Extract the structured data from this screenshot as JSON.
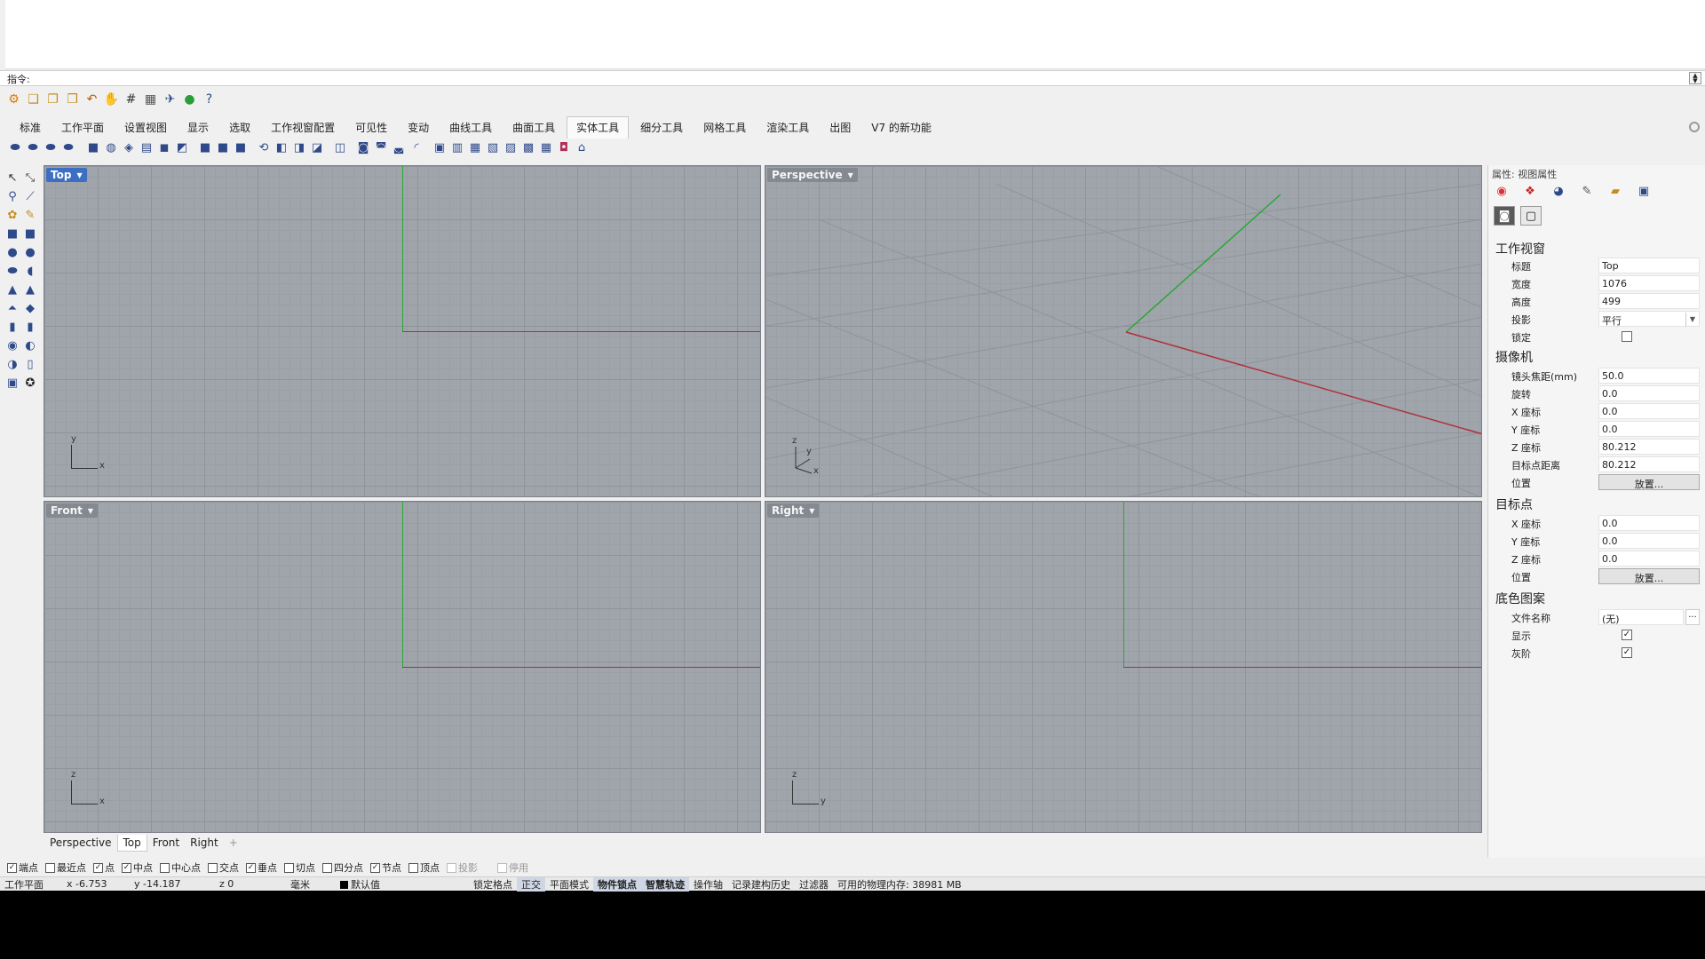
{
  "command": {
    "prompt_label": "指令:"
  },
  "tabs": [
    "标准",
    "工作平面",
    "设置视图",
    "显示",
    "选取",
    "工作视窗配置",
    "可见性",
    "变动",
    "曲线工具",
    "曲面工具",
    "实体工具",
    "细分工具",
    "网格工具",
    "渲染工具",
    "出图",
    "V7 的新功能"
  ],
  "active_tab": "实体工具",
  "viewports": {
    "top": {
      "title": "Top",
      "gizmo_v": "y",
      "gizmo_h": "x"
    },
    "perspective": {
      "title": "Perspective",
      "gizmo_z": "z",
      "gizmo_y": "y",
      "gizmo_x": "x"
    },
    "front": {
      "title": "Front",
      "gizmo_v": "z",
      "gizmo_h": "x"
    },
    "right": {
      "title": "Right",
      "gizmo_v": "z",
      "gizmo_h": "y"
    }
  },
  "view_tabs": [
    "Perspective",
    "Top",
    "Front",
    "Right"
  ],
  "view_tab_add": "+",
  "panel": {
    "title": "属性: 视图属性",
    "sections": {
      "viewport": "工作视窗",
      "camera": "摄像机",
      "target": "目标点",
      "wallpaper": "底色图案"
    },
    "viewport_rows": [
      {
        "label": "标题",
        "value": "Top"
      },
      {
        "label": "宽度",
        "value": "1076"
      },
      {
        "label": "高度",
        "value": "499"
      },
      {
        "label": "投影",
        "value": "平行"
      },
      {
        "label": "锁定",
        "value": ""
      }
    ],
    "camera_rows": [
      {
        "label": "镜头焦距(mm)",
        "value": "50.0"
      },
      {
        "label": "旋转",
        "value": "0.0"
      },
      {
        "label": "X 座标",
        "value": "0.0"
      },
      {
        "label": "Y 座标",
        "value": "0.0"
      },
      {
        "label": "Z 座标",
        "value": "80.212"
      },
      {
        "label": "目标点距离",
        "value": "80.212"
      },
      {
        "label": "位置",
        "value": "放置..."
      }
    ],
    "target_rows": [
      {
        "label": "X 座标",
        "value": "0.0"
      },
      {
        "label": "Y 座标",
        "value": "0.0"
      },
      {
        "label": "Z 座标",
        "value": "0.0"
      },
      {
        "label": "位置",
        "value": "放置..."
      }
    ],
    "wallpaper_rows": [
      {
        "label": "文件名称",
        "value": "(无)"
      },
      {
        "label": "显示",
        "value": "✓"
      },
      {
        "label": "灰阶",
        "value": "✓"
      }
    ],
    "browse_label": "..."
  },
  "osnaps": [
    {
      "label": "端点",
      "checked": true
    },
    {
      "label": "最近点",
      "checked": false
    },
    {
      "label": "点",
      "checked": true
    },
    {
      "label": "中点",
      "checked": true
    },
    {
      "label": "中心点",
      "checked": false
    },
    {
      "label": "交点",
      "checked": false
    },
    {
      "label": "垂点",
      "checked": true
    },
    {
      "label": "切点",
      "checked": false
    },
    {
      "label": "四分点",
      "checked": false
    },
    {
      "label": "节点",
      "checked": true
    },
    {
      "label": "顶点",
      "checked": false
    },
    {
      "label": "投影",
      "checked": false,
      "dim": true
    },
    {
      "label": "停用",
      "checked": false,
      "dim": true
    }
  ],
  "status": {
    "cplane": "工作平面",
    "x": "x -6.753",
    "y": "y -14.187",
    "z": "z 0",
    "units": "毫米",
    "layer": "默认值",
    "grid_snap": "锁定格点",
    "ortho": "正交",
    "planar": "平面模式",
    "osnap": "物件锁点",
    "smarttrack": "智慧轨迹",
    "gumball": "操作轴",
    "history": "记录建构历史",
    "filter": "过滤器",
    "memory": "可用的物理内存: 38981 MB"
  }
}
